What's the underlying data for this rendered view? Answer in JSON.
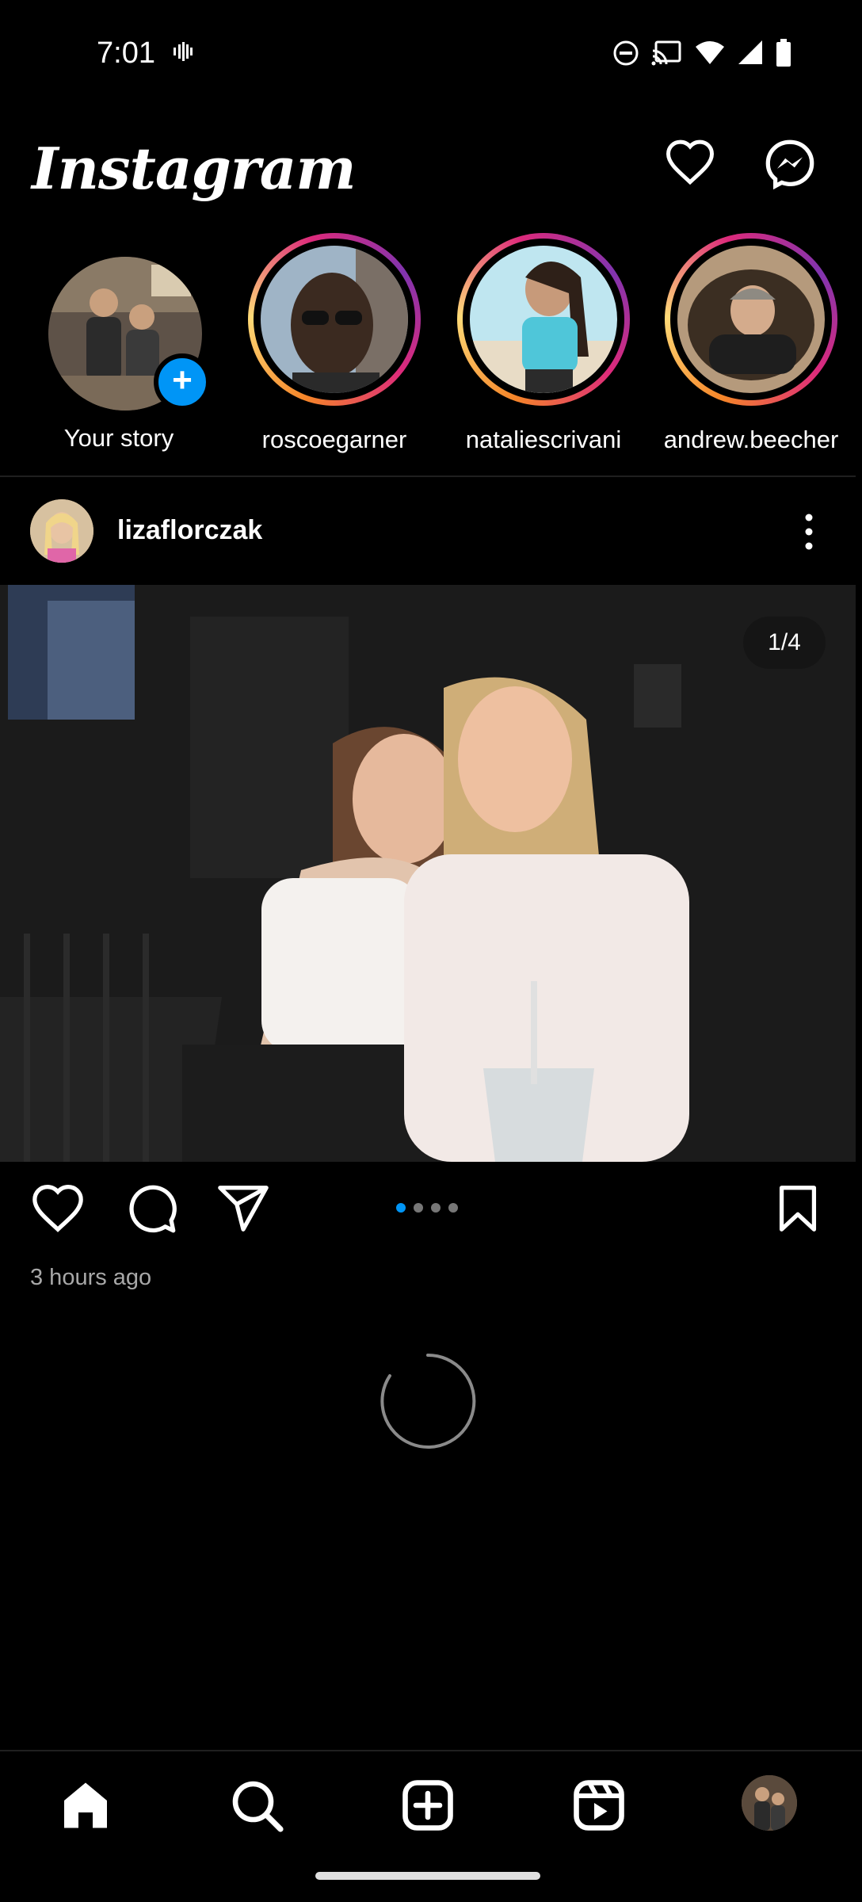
{
  "status_bar": {
    "time": "7:01",
    "icons": [
      "vibrate-icon",
      "dnd-icon",
      "cast-icon",
      "wifi-icon",
      "signal-icon",
      "battery-icon"
    ]
  },
  "header": {
    "logo": "Instagram",
    "icons": [
      "heart-icon",
      "messenger-icon"
    ]
  },
  "stories": [
    {
      "label": "Your story",
      "own": true
    },
    {
      "label": "roscoegarner",
      "own": false
    },
    {
      "label": "nataliescrivani",
      "own": false
    },
    {
      "label": "andrew.beecher",
      "own": false
    }
  ],
  "post": {
    "username": "lizaflorczak",
    "counter": "1/4",
    "carousel_total": 4,
    "carousel_index": 1,
    "time_ago": "3 hours ago"
  },
  "bottom_nav": [
    "home-icon",
    "search-icon",
    "create-icon",
    "reels-icon",
    "profile-avatar"
  ],
  "colors": {
    "accent": "#0095f6",
    "background": "#000000",
    "muted_text": "#a8a8a8"
  }
}
